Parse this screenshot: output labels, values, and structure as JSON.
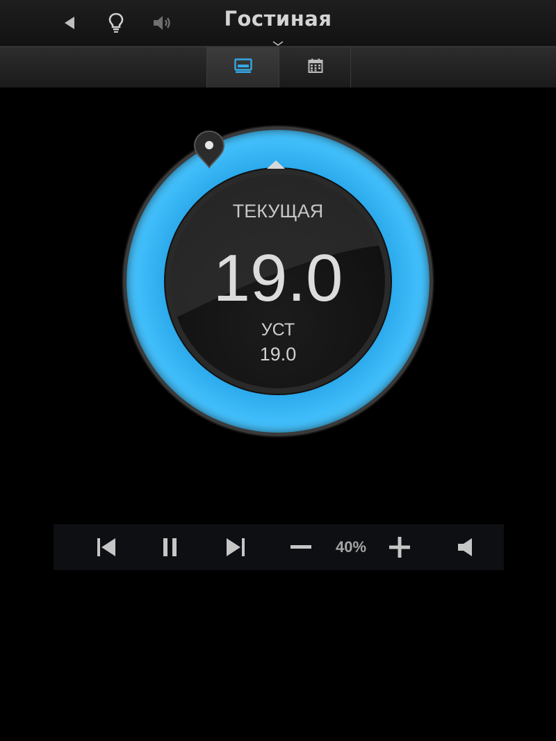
{
  "header": {
    "title": "Гостиная",
    "icons": [
      "back-arrow-icon",
      "lightbulb-icon",
      "speaker-icon"
    ]
  },
  "tabs": [
    {
      "name": "thermostat-tab",
      "icon": "display-icon",
      "active": true
    },
    {
      "name": "schedule-tab",
      "icon": "calendar-icon",
      "active": false
    }
  ],
  "thermostat": {
    "current_label": "ТЕКУЩАЯ",
    "current_value": "19.0",
    "setpoint_label": "УСТ",
    "setpoint_value": "19.0"
  },
  "media": {
    "volume_level": "40%",
    "controls": [
      "previous-track-icon",
      "pause-icon",
      "next-track-icon",
      "volume-down-icon",
      "volume-up-icon",
      "mute-speaker-icon"
    ]
  },
  "colors": {
    "accent": "#2aa8ea",
    "active_tab_icon": "#35a9e6",
    "background": "#000000"
  }
}
